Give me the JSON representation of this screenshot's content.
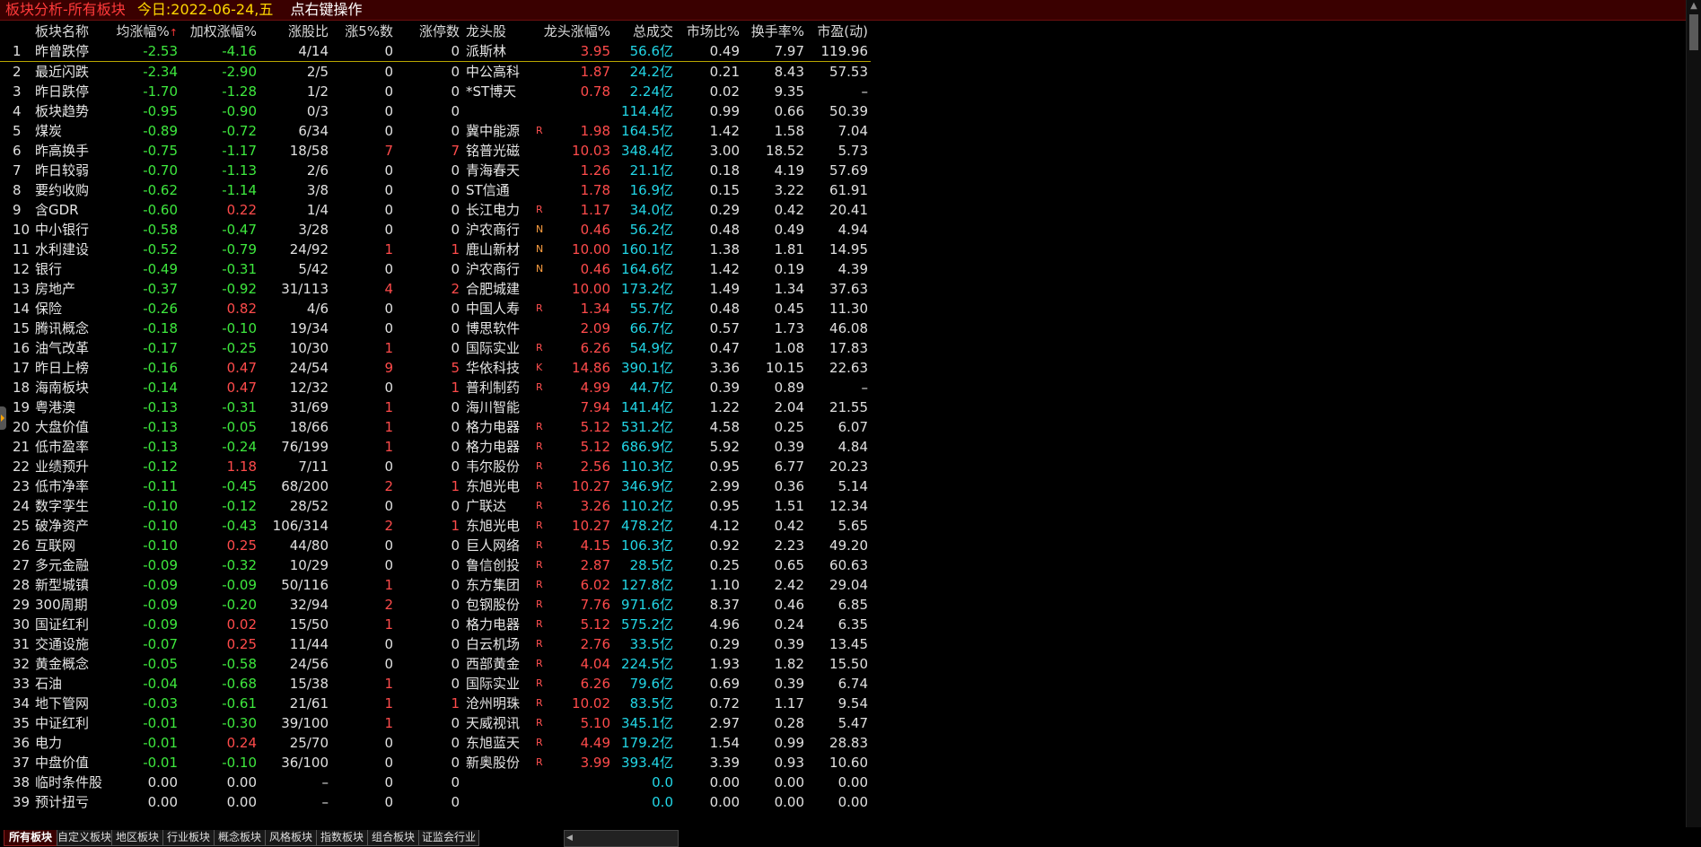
{
  "title": {
    "main": "板块分析-所有板块",
    "today_label": "今日:",
    "date": "2022-06-24,五",
    "hint": "点右键操作"
  },
  "columns": {
    "name": "板块名称",
    "avg_change": "均涨幅%",
    "sort_arrow": "↑",
    "weighted_change": "加权涨幅%",
    "up_ratio": "涨股比",
    "up5_count": "涨5%数",
    "limit_count": "涨停数",
    "leader": "龙头股",
    "leader_change": "龙头涨幅%",
    "turnover": "总成交",
    "market_ratio": "市场比%",
    "turnover_rate": "换手率%",
    "pe": "市盈(动)"
  },
  "rows": [
    {
      "idx": "1",
      "name": "昨曾跌停",
      "avg": "-2.53",
      "wtd": "-4.16",
      "ratio": "4/14",
      "up5": "0",
      "lim": "0",
      "leader": "派斯林",
      "flag": "",
      "lpct": "3.95",
      "vol": "56.6亿",
      "mkt": "0.49",
      "turn": "7.97",
      "pe": "119.96"
    },
    {
      "idx": "2",
      "name": "最近闪跌",
      "avg": "-2.34",
      "wtd": "-2.90",
      "ratio": "2/5",
      "up5": "0",
      "lim": "0",
      "leader": "中公高科",
      "flag": "",
      "lpct": "1.87",
      "vol": "24.2亿",
      "mkt": "0.21",
      "turn": "8.43",
      "pe": "57.53"
    },
    {
      "idx": "3",
      "name": "昨日跌停",
      "avg": "-1.70",
      "wtd": "-1.28",
      "ratio": "1/2",
      "up5": "0",
      "lim": "0",
      "leader": "*ST博天",
      "flag": "",
      "lpct": "0.78",
      "vol": "2.24亿",
      "mkt": "0.02",
      "turn": "9.35",
      "pe": "–"
    },
    {
      "idx": "4",
      "name": "板块趋势",
      "avg": "-0.95",
      "wtd": "-0.90",
      "ratio": "0/3",
      "up5": "0",
      "lim": "0",
      "leader": "",
      "flag": "",
      "lpct": "",
      "vol": "114.4亿",
      "mkt": "0.99",
      "turn": "0.66",
      "pe": "50.39"
    },
    {
      "idx": "5",
      "name": "煤炭",
      "avg": "-0.89",
      "wtd": "-0.72",
      "ratio": "6/34",
      "up5": "0",
      "lim": "0",
      "leader": "冀中能源",
      "flag": "R",
      "lpct": "1.98",
      "vol": "164.5亿",
      "mkt": "1.42",
      "turn": "1.58",
      "pe": "7.04"
    },
    {
      "idx": "6",
      "name": "昨高换手",
      "avg": "-0.75",
      "wtd": "-1.17",
      "ratio": "18/58",
      "up5": "7",
      "lim": "7",
      "leader": "铭普光磁",
      "flag": "",
      "lpct": "10.03",
      "vol": "348.4亿",
      "mkt": "3.00",
      "turn": "18.52",
      "pe": "5.73"
    },
    {
      "idx": "7",
      "name": "昨日较弱",
      "avg": "-0.70",
      "wtd": "-1.13",
      "ratio": "2/6",
      "up5": "0",
      "lim": "0",
      "leader": "青海春天",
      "flag": "",
      "lpct": "1.26",
      "vol": "21.1亿",
      "mkt": "0.18",
      "turn": "4.19",
      "pe": "57.69"
    },
    {
      "idx": "8",
      "name": "要约收购",
      "avg": "-0.62",
      "wtd": "-1.14",
      "ratio": "3/8",
      "up5": "0",
      "lim": "0",
      "leader": "ST信通",
      "flag": "",
      "lpct": "1.78",
      "vol": "16.9亿",
      "mkt": "0.15",
      "turn": "3.22",
      "pe": "61.91"
    },
    {
      "idx": "9",
      "name": "含GDR",
      "avg": "-0.60",
      "wtd": "0.22",
      "ratio": "1/4",
      "up5": "0",
      "lim": "0",
      "leader": "长江电力",
      "flag": "R",
      "lpct": "1.17",
      "vol": "34.0亿",
      "mkt": "0.29",
      "turn": "0.42",
      "pe": "20.41"
    },
    {
      "idx": "10",
      "name": "中小银行",
      "avg": "-0.58",
      "wtd": "-0.47",
      "ratio": "3/28",
      "up5": "0",
      "lim": "0",
      "leader": "沪农商行",
      "flag": "N",
      "lpct": "0.46",
      "vol": "56.2亿",
      "mkt": "0.48",
      "turn": "0.49",
      "pe": "4.94"
    },
    {
      "idx": "11",
      "name": "水利建设",
      "avg": "-0.52",
      "wtd": "-0.79",
      "ratio": "24/92",
      "up5": "1",
      "lim": "1",
      "leader": "鹿山新材",
      "flag": "N",
      "lpct": "10.00",
      "vol": "160.1亿",
      "mkt": "1.38",
      "turn": "1.81",
      "pe": "14.95"
    },
    {
      "idx": "12",
      "name": "银行",
      "avg": "-0.49",
      "wtd": "-0.31",
      "ratio": "5/42",
      "up5": "0",
      "lim": "0",
      "leader": "沪农商行",
      "flag": "N",
      "lpct": "0.46",
      "vol": "164.6亿",
      "mkt": "1.42",
      "turn": "0.19",
      "pe": "4.39"
    },
    {
      "idx": "13",
      "name": "房地产",
      "avg": "-0.37",
      "wtd": "-0.92",
      "ratio": "31/113",
      "up5": "4",
      "lim": "2",
      "leader": "合肥城建",
      "flag": "",
      "lpct": "10.00",
      "vol": "173.2亿",
      "mkt": "1.49",
      "turn": "1.34",
      "pe": "37.63"
    },
    {
      "idx": "14",
      "name": "保险",
      "avg": "-0.26",
      "wtd": "0.82",
      "ratio": "4/6",
      "up5": "0",
      "lim": "0",
      "leader": "中国人寿",
      "flag": "R",
      "lpct": "1.34",
      "vol": "55.7亿",
      "mkt": "0.48",
      "turn": "0.45",
      "pe": "11.30"
    },
    {
      "idx": "15",
      "name": "腾讯概念",
      "avg": "-0.18",
      "wtd": "-0.10",
      "ratio": "19/34",
      "up5": "0",
      "lim": "0",
      "leader": "博思软件",
      "flag": "",
      "lpct": "2.09",
      "vol": "66.7亿",
      "mkt": "0.57",
      "turn": "1.73",
      "pe": "46.08"
    },
    {
      "idx": "16",
      "name": "油气改革",
      "avg": "-0.17",
      "wtd": "-0.25",
      "ratio": "10/30",
      "up5": "1",
      "lim": "0",
      "leader": "国际实业",
      "flag": "R",
      "lpct": "6.26",
      "vol": "54.9亿",
      "mkt": "0.47",
      "turn": "1.08",
      "pe": "17.83"
    },
    {
      "idx": "17",
      "name": "昨日上榜",
      "avg": "-0.16",
      "wtd": "0.47",
      "ratio": "24/54",
      "up5": "9",
      "lim": "5",
      "leader": "华依科技",
      "flag": "K",
      "lpct": "14.86",
      "vol": "390.1亿",
      "mkt": "3.36",
      "turn": "10.15",
      "pe": "22.63"
    },
    {
      "idx": "18",
      "name": "海南板块",
      "avg": "-0.14",
      "wtd": "0.47",
      "ratio": "12/32",
      "up5": "0",
      "lim": "1",
      "leader": "普利制药",
      "flag": "R",
      "lpct": "4.99",
      "vol": "44.7亿",
      "mkt": "0.39",
      "turn": "0.89",
      "pe": "–"
    },
    {
      "idx": "19",
      "name": "粤港澳",
      "avg": "-0.13",
      "wtd": "-0.31",
      "ratio": "31/69",
      "up5": "1",
      "lim": "0",
      "leader": "海川智能",
      "flag": "",
      "lpct": "7.94",
      "vol": "141.4亿",
      "mkt": "1.22",
      "turn": "2.04",
      "pe": "21.55"
    },
    {
      "idx": "20",
      "name": "大盘价值",
      "avg": "-0.13",
      "wtd": "-0.05",
      "ratio": "18/66",
      "up5": "1",
      "lim": "0",
      "leader": "格力电器",
      "flag": "R",
      "lpct": "5.12",
      "vol": "531.2亿",
      "mkt": "4.58",
      "turn": "0.25",
      "pe": "6.07"
    },
    {
      "idx": "21",
      "name": "低市盈率",
      "avg": "-0.13",
      "wtd": "-0.24",
      "ratio": "76/199",
      "up5": "1",
      "lim": "0",
      "leader": "格力电器",
      "flag": "R",
      "lpct": "5.12",
      "vol": "686.9亿",
      "mkt": "5.92",
      "turn": "0.39",
      "pe": "4.84"
    },
    {
      "idx": "22",
      "name": "业绩预升",
      "avg": "-0.12",
      "wtd": "1.18",
      "ratio": "7/11",
      "up5": "0",
      "lim": "0",
      "leader": "韦尔股份",
      "flag": "R",
      "lpct": "2.56",
      "vol": "110.3亿",
      "mkt": "0.95",
      "turn": "6.77",
      "pe": "20.23"
    },
    {
      "idx": "23",
      "name": "低市净率",
      "avg": "-0.11",
      "wtd": "-0.45",
      "ratio": "68/200",
      "up5": "2",
      "lim": "1",
      "leader": "东旭光电",
      "flag": "R",
      "lpct": "10.27",
      "vol": "346.9亿",
      "mkt": "2.99",
      "turn": "0.36",
      "pe": "5.14"
    },
    {
      "idx": "24",
      "name": "数字孪生",
      "avg": "-0.10",
      "wtd": "-0.12",
      "ratio": "28/52",
      "up5": "0",
      "lim": "0",
      "leader": "广联达",
      "flag": "R",
      "lpct": "3.26",
      "vol": "110.2亿",
      "mkt": "0.95",
      "turn": "1.51",
      "pe": "12.34"
    },
    {
      "idx": "25",
      "name": "破净资产",
      "avg": "-0.10",
      "wtd": "-0.43",
      "ratio": "106/314",
      "up5": "2",
      "lim": "1",
      "leader": "东旭光电",
      "flag": "R",
      "lpct": "10.27",
      "vol": "478.2亿",
      "mkt": "4.12",
      "turn": "0.42",
      "pe": "5.65"
    },
    {
      "idx": "26",
      "name": "互联网",
      "avg": "-0.10",
      "wtd": "0.25",
      "ratio": "44/80",
      "up5": "0",
      "lim": "0",
      "leader": "巨人网络",
      "flag": "R",
      "lpct": "4.15",
      "vol": "106.3亿",
      "mkt": "0.92",
      "turn": "2.23",
      "pe": "49.20"
    },
    {
      "idx": "27",
      "name": "多元金融",
      "avg": "-0.09",
      "wtd": "-0.32",
      "ratio": "10/29",
      "up5": "0",
      "lim": "0",
      "leader": "鲁信创投",
      "flag": "R",
      "lpct": "2.87",
      "vol": "28.5亿",
      "mkt": "0.25",
      "turn": "0.65",
      "pe": "60.63"
    },
    {
      "idx": "28",
      "name": "新型城镇",
      "avg": "-0.09",
      "wtd": "-0.09",
      "ratio": "50/116",
      "up5": "1",
      "lim": "0",
      "leader": "东方集团",
      "flag": "R",
      "lpct": "6.02",
      "vol": "127.8亿",
      "mkt": "1.10",
      "turn": "2.42",
      "pe": "29.04"
    },
    {
      "idx": "29",
      "name": "300周期",
      "avg": "-0.09",
      "wtd": "-0.20",
      "ratio": "32/94",
      "up5": "2",
      "lim": "0",
      "leader": "包钢股份",
      "flag": "R",
      "lpct": "7.76",
      "vol": "971.6亿",
      "mkt": "8.37",
      "turn": "0.46",
      "pe": "6.85"
    },
    {
      "idx": "30",
      "name": "国证红利",
      "avg": "-0.09",
      "wtd": "0.02",
      "ratio": "15/50",
      "up5": "1",
      "lim": "0",
      "leader": "格力电器",
      "flag": "R",
      "lpct": "5.12",
      "vol": "575.2亿",
      "mkt": "4.96",
      "turn": "0.24",
      "pe": "6.35"
    },
    {
      "idx": "31",
      "name": "交通设施",
      "avg": "-0.07",
      "wtd": "0.25",
      "ratio": "11/44",
      "up5": "0",
      "lim": "0",
      "leader": "白云机场",
      "flag": "R",
      "lpct": "2.76",
      "vol": "33.5亿",
      "mkt": "0.29",
      "turn": "0.39",
      "pe": "13.45"
    },
    {
      "idx": "32",
      "name": "黄金概念",
      "avg": "-0.05",
      "wtd": "-0.58",
      "ratio": "24/56",
      "up5": "0",
      "lim": "0",
      "leader": "西部黄金",
      "flag": "R",
      "lpct": "4.04",
      "vol": "224.5亿",
      "mkt": "1.93",
      "turn": "1.82",
      "pe": "15.50"
    },
    {
      "idx": "33",
      "name": "石油",
      "avg": "-0.04",
      "wtd": "-0.68",
      "ratio": "15/38",
      "up5": "1",
      "lim": "0",
      "leader": "国际实业",
      "flag": "R",
      "lpct": "6.26",
      "vol": "79.6亿",
      "mkt": "0.69",
      "turn": "0.39",
      "pe": "6.74"
    },
    {
      "idx": "34",
      "name": "地下管网",
      "avg": "-0.03",
      "wtd": "-0.61",
      "ratio": "21/61",
      "up5": "1",
      "lim": "1",
      "leader": "沧州明珠",
      "flag": "R",
      "lpct": "10.02",
      "vol": "83.5亿",
      "mkt": "0.72",
      "turn": "1.17",
      "pe": "9.54"
    },
    {
      "idx": "35",
      "name": "中证红利",
      "avg": "-0.01",
      "wtd": "-0.30",
      "ratio": "39/100",
      "up5": "1",
      "lim": "0",
      "leader": "天威视讯",
      "flag": "R",
      "lpct": "5.10",
      "vol": "345.1亿",
      "mkt": "2.97",
      "turn": "0.28",
      "pe": "5.47"
    },
    {
      "idx": "36",
      "name": "电力",
      "avg": "-0.01",
      "wtd": "0.24",
      "ratio": "25/70",
      "up5": "0",
      "lim": "0",
      "leader": "东旭蓝天",
      "flag": "R",
      "lpct": "4.49",
      "vol": "179.2亿",
      "mkt": "1.54",
      "turn": "0.99",
      "pe": "28.83"
    },
    {
      "idx": "37",
      "name": "中盘价值",
      "avg": "-0.01",
      "wtd": "-0.10",
      "ratio": "36/100",
      "up5": "0",
      "lim": "0",
      "leader": "新奥股份",
      "flag": "R",
      "lpct": "3.99",
      "vol": "393.4亿",
      "mkt": "3.39",
      "turn": "0.93",
      "pe": "10.60"
    },
    {
      "idx": "38",
      "name": "临时条件股",
      "avg": "0.00",
      "wtd": "0.00",
      "ratio": "–",
      "up5": "0",
      "lim": "0",
      "leader": "",
      "flag": "",
      "lpct": "",
      "vol": "0.0",
      "mkt": "0.00",
      "turn": "0.00",
      "pe": "0.00"
    },
    {
      "idx": "39",
      "name": "预计扭亏",
      "avg": "0.00",
      "wtd": "0.00",
      "ratio": "–",
      "up5": "0",
      "lim": "0",
      "leader": "",
      "flag": "",
      "lpct": "",
      "vol": "0.0",
      "mkt": "0.00",
      "turn": "0.00",
      "pe": "0.00"
    }
  ],
  "tabs": [
    {
      "label": "所有板块",
      "active": true
    },
    {
      "label": "自定义板块",
      "active": false
    },
    {
      "label": "地区板块",
      "active": false
    },
    {
      "label": "行业板块",
      "active": false
    },
    {
      "label": "概念板块",
      "active": false
    },
    {
      "label": "风格板块",
      "active": false
    },
    {
      "label": "指数板块",
      "active": false
    },
    {
      "label": "组合板块",
      "active": false
    },
    {
      "label": "证监会行业",
      "active": false
    }
  ],
  "icons": {
    "scroll_up": "triangle-up-icon",
    "side_handle": "expand-arrow-icon",
    "tab_scroll_left": "triangle-left-icon"
  },
  "colors": {
    "background": "#000000",
    "title_bg": "#3a0000",
    "up": "#ff4b4b",
    "down": "#3ee83e",
    "turnover": "#22d6e6",
    "date": "#ffd700"
  }
}
